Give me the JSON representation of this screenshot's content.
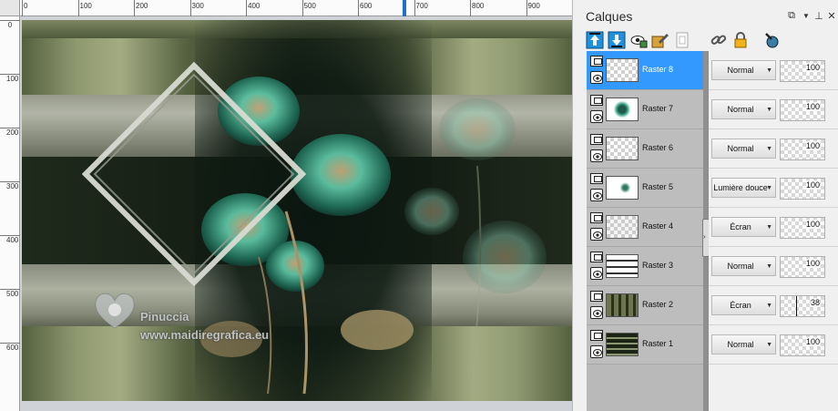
{
  "ruler": {
    "h_labels": [
      "0",
      "100",
      "200",
      "300",
      "400",
      "500",
      "600",
      "700",
      "800",
      "900"
    ],
    "v_labels": [
      "0",
      "100",
      "200",
      "300",
      "400",
      "500",
      "600"
    ]
  },
  "watermark": {
    "line1": "Pinuccia",
    "line2": "www.maidiregrafica.eu"
  },
  "panel": {
    "title": "Calques",
    "header_icons": [
      "restore-icon",
      "dropdown-icon",
      "pin-icon",
      "close-icon"
    ],
    "toolbar_icons": [
      "move-layer-up-icon",
      "move-layer-down-icon",
      "visibility-icon",
      "edit-layer-icon",
      "delete-layer-icon",
      "link-icon",
      "lock-icon",
      "color-picker-icon"
    ]
  },
  "layers": [
    {
      "name": "Raster 8",
      "blend": "Normal",
      "opacity": "100",
      "opacity_fraction": 1.0,
      "active": true,
      "thumb": "checker"
    },
    {
      "name": "Raster 7",
      "blend": "Normal",
      "opacity": "100",
      "opacity_fraction": 1.0,
      "active": false,
      "thumb": "flower-small"
    },
    {
      "name": "Raster 6",
      "blend": "Normal",
      "opacity": "100",
      "opacity_fraction": 1.0,
      "active": false,
      "thumb": "checker"
    },
    {
      "name": "Raster 5",
      "blend": "Lumière douce",
      "opacity": "100",
      "opacity_fraction": 1.0,
      "active": false,
      "thumb": "flower-tiny"
    },
    {
      "name": "Raster 4",
      "blend": "Écran",
      "opacity": "100",
      "opacity_fraction": 1.0,
      "active": false,
      "thumb": "checker-texture"
    },
    {
      "name": "Raster 3",
      "blend": "Normal",
      "opacity": "100",
      "opacity_fraction": 1.0,
      "active": false,
      "thumb": "stripes"
    },
    {
      "name": "Raster 2",
      "blend": "Écran",
      "opacity": "38",
      "opacity_fraction": 0.38,
      "active": false,
      "thumb": "olive-pattern"
    },
    {
      "name": "Raster 1",
      "blend": "Normal",
      "opacity": "100",
      "opacity_fraction": 1.0,
      "active": false,
      "thumb": "dark-stripes"
    }
  ],
  "colors": {
    "accent": "#3399ff",
    "olive": "#8f9970",
    "teal_flower": "#3fa88a"
  }
}
